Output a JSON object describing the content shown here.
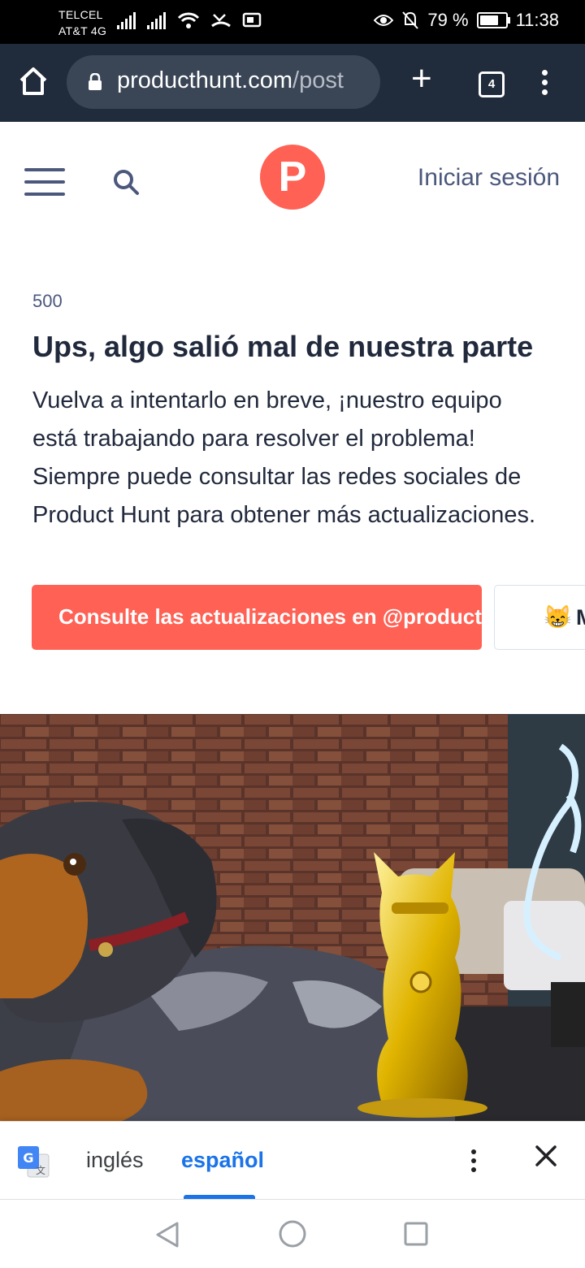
{
  "status": {
    "carrier_1": "TELCEL",
    "carrier_2": "AT&T 4G",
    "battery": "79 %",
    "time": "11:38"
  },
  "browser": {
    "url_host": "producthunt.com",
    "url_path": "/post",
    "tab_count": "4"
  },
  "header": {
    "logo_letter": "P",
    "signin_label": "Iniciar sesión"
  },
  "error": {
    "code": "500",
    "title": "Ups, algo salió mal de nuestra parte",
    "message": "Vuelva a intentarlo en breve, ¡nuestro equipo está trabajando para resolver el problema! Siempre puede consultar las redes sociales de Product Hunt para obtener más actualizaciones."
  },
  "buttons": {
    "primary_label": "Consulte las actualizaciones en @producthunt",
    "secondary_emoji": "😸",
    "secondary_label": "M"
  },
  "translate_bar": {
    "lang_source": "inglés",
    "lang_target": "español"
  },
  "colors": {
    "brand": "#ff6154",
    "browser_bar": "#202b3b",
    "link_blue": "#1a73e8"
  }
}
